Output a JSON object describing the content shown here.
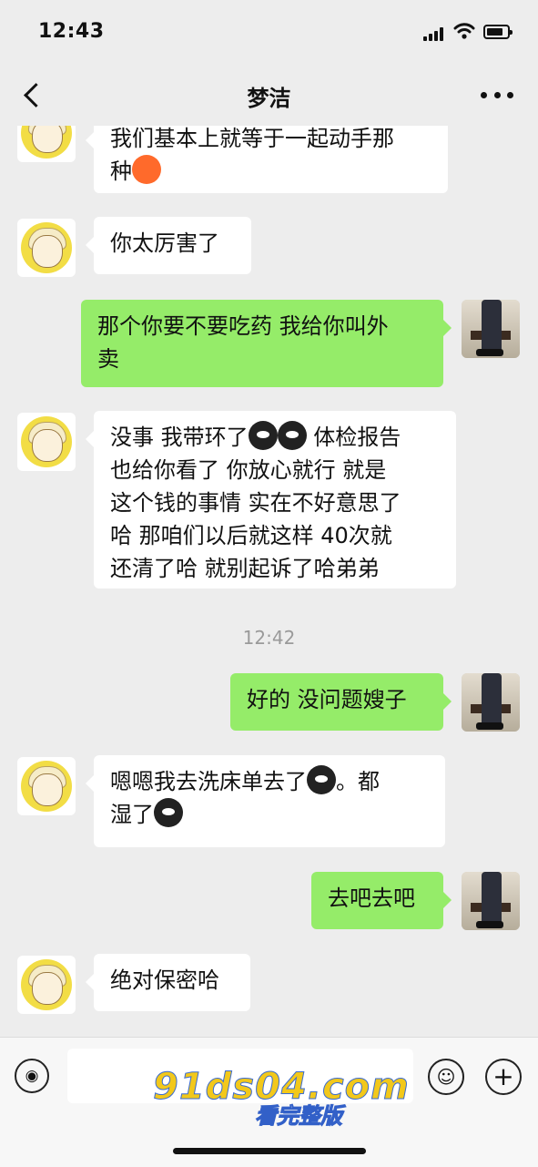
{
  "status_bar": {
    "time": "12:43"
  },
  "nav": {
    "title": "梦洁"
  },
  "messages": [
    {
      "from": "her",
      "lines": [
        "我们基本上就等于一起动手那",
        "种"
      ],
      "emoji_after": "angry-emoji"
    },
    {
      "from": "her",
      "text": "你太厉害了"
    },
    {
      "from": "me",
      "lines": [
        "那个你要不要吃药 我给你叫外",
        "卖"
      ]
    },
    {
      "from": "her",
      "line1_a": "没事 我带环了",
      "line1_b": " 体检报告",
      "lines_rest": [
        "也给你看了 你放心就行 就是",
        "这个钱的事情 实在不好意思了",
        "哈 那咱们以后就这样 40次就",
        "还清了哈 就别起诉了哈弟弟"
      ]
    },
    {
      "timestamp": "12:42"
    },
    {
      "from": "me",
      "text": "好的 没问题嫂子"
    },
    {
      "from": "her",
      "line1_a": " 嗯嗯我去洗床单去了",
      "line1_b": "。都",
      "line2": "湿了"
    },
    {
      "from": "me",
      "text": "去吧去吧"
    },
    {
      "from": "her",
      "text": "绝对保密哈"
    }
  ],
  "input_bar": {
    "voice_icon": "voice-icon",
    "emoji_icon": "smile-icon",
    "more_icon": "plus-icon",
    "emoji_glyph": "☺",
    "plus_glyph": "+",
    "voice_glyph": "◉"
  },
  "watermark": {
    "line1": "91ds04.com",
    "line2": "看完整版"
  },
  "colors": {
    "background": "#ededed",
    "outgoing_bubble": "#95ec69",
    "incoming_bubble": "#ffffff"
  }
}
